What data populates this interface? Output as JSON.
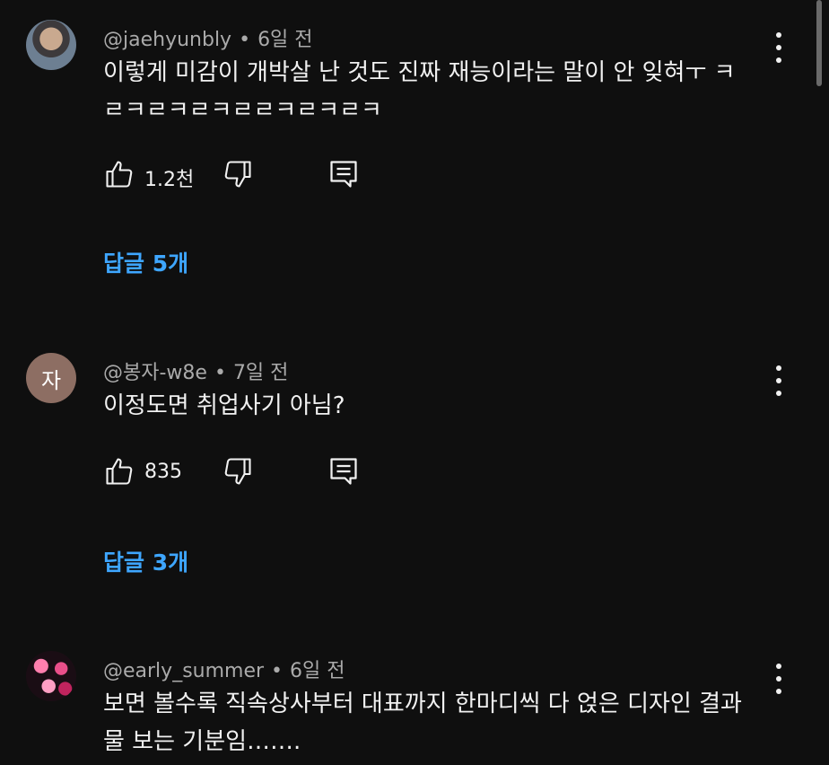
{
  "comments": [
    {
      "author": "@jaehyunbly",
      "time": "6일 전",
      "text_lines": [
        "이렇게 미감이 개박살 난 것도 진짜 재능이라는 말이 안 잊혀ㅜ ㅋ",
        "ㄹㅋㄹㅋㄹㅋㄹㄹㅋㄹㅋㄹㅋ"
      ],
      "likes": "1.2천",
      "replies": "답글 5개",
      "avatar": "photo"
    },
    {
      "author": "@봉자-w8e",
      "time": "7일 전",
      "text_lines": [
        "이정도면 취업사기 아님?"
      ],
      "likes": "835",
      "replies": "답글 3개",
      "avatar": "letter",
      "avatar_letter": "자"
    },
    {
      "author": "@early_summer",
      "time": "6일 전",
      "text_lines": [
        "보면 볼수록 직속상사부터 대표까지 한마디씩 다 얹은 디자인 결과",
        "물 보는 기분임……."
      ],
      "avatar": "art"
    }
  ],
  "meta_separator": "•",
  "icons": {
    "like": "thumbs-up-icon",
    "dislike": "thumbs-down-icon",
    "reply": "reply-icon",
    "more": "more-vert-icon"
  },
  "colors": {
    "background": "#0f0f0f",
    "text": "#f1f1f1",
    "meta": "#aaaaaa",
    "link": "#3ea6ff"
  }
}
